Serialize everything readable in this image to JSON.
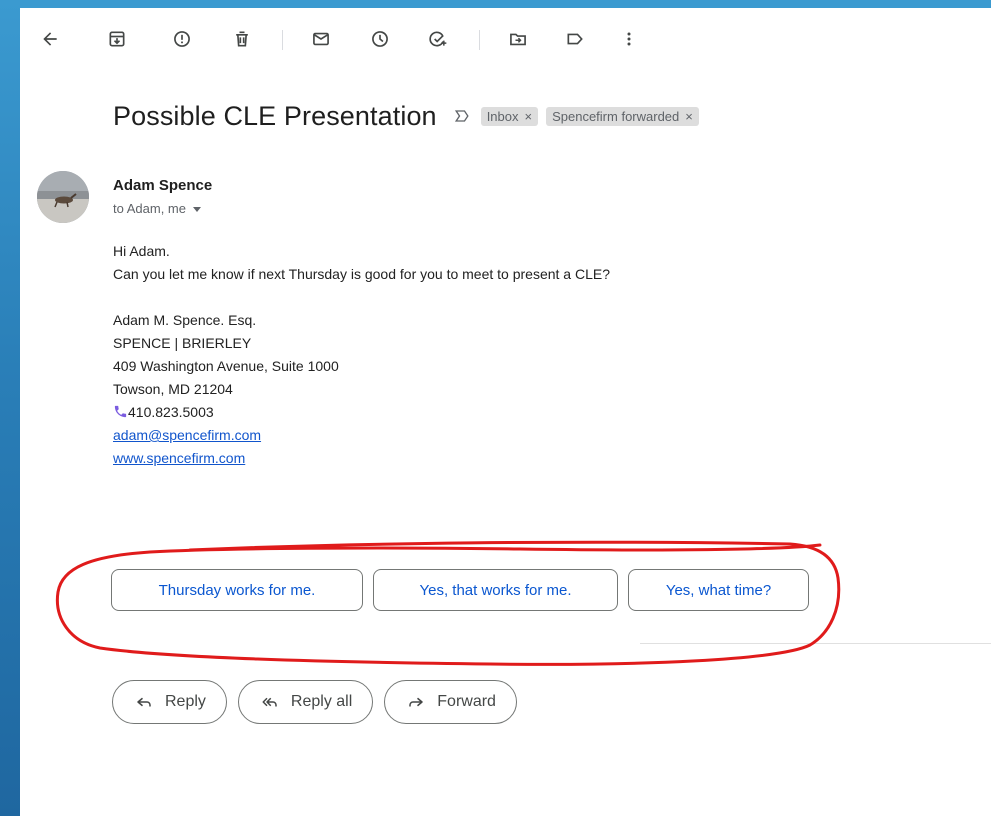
{
  "toolbar": {
    "icons": [
      "back-arrow-icon",
      "archive-icon",
      "report-spam-icon",
      "delete-icon",
      "mark-unread-icon",
      "snooze-icon",
      "add-to-tasks-icon",
      "move-to-icon",
      "labels-icon",
      "more-vert-icon"
    ]
  },
  "email": {
    "subject": "Possible CLE Presentation",
    "labels": [
      "Inbox",
      "Spencefirm forwarded"
    ],
    "label_remove": "×",
    "sender": "Adam Spence",
    "recipients": "to Adam, me",
    "body": {
      "greeting": "Hi Adam.",
      "message": "Can you let me know if next Thursday is good for you to meet to present a CLE?",
      "signature": {
        "name": "Adam M. Spence. Esq.",
        "firm": "SPENCE | BRIERLEY",
        "address1": "409 Washington Avenue, Suite 1000",
        "address2": "Towson, MD 21204",
        "phone": "410.823.5003",
        "email": "adam@spencefirm.com",
        "website": "www.spencefirm.com"
      }
    }
  },
  "smart_replies": [
    "Thursday works for me.",
    "Yes, that works for me.",
    "Yes, what time?"
  ],
  "actions": {
    "reply": "Reply",
    "reply_all": "Reply all",
    "forward": "Forward"
  },
  "colors": {
    "annotation": "#e01b1b",
    "link": "#1155cc",
    "chip_text": "#0b57d0",
    "frame": "#2f8fc6"
  }
}
